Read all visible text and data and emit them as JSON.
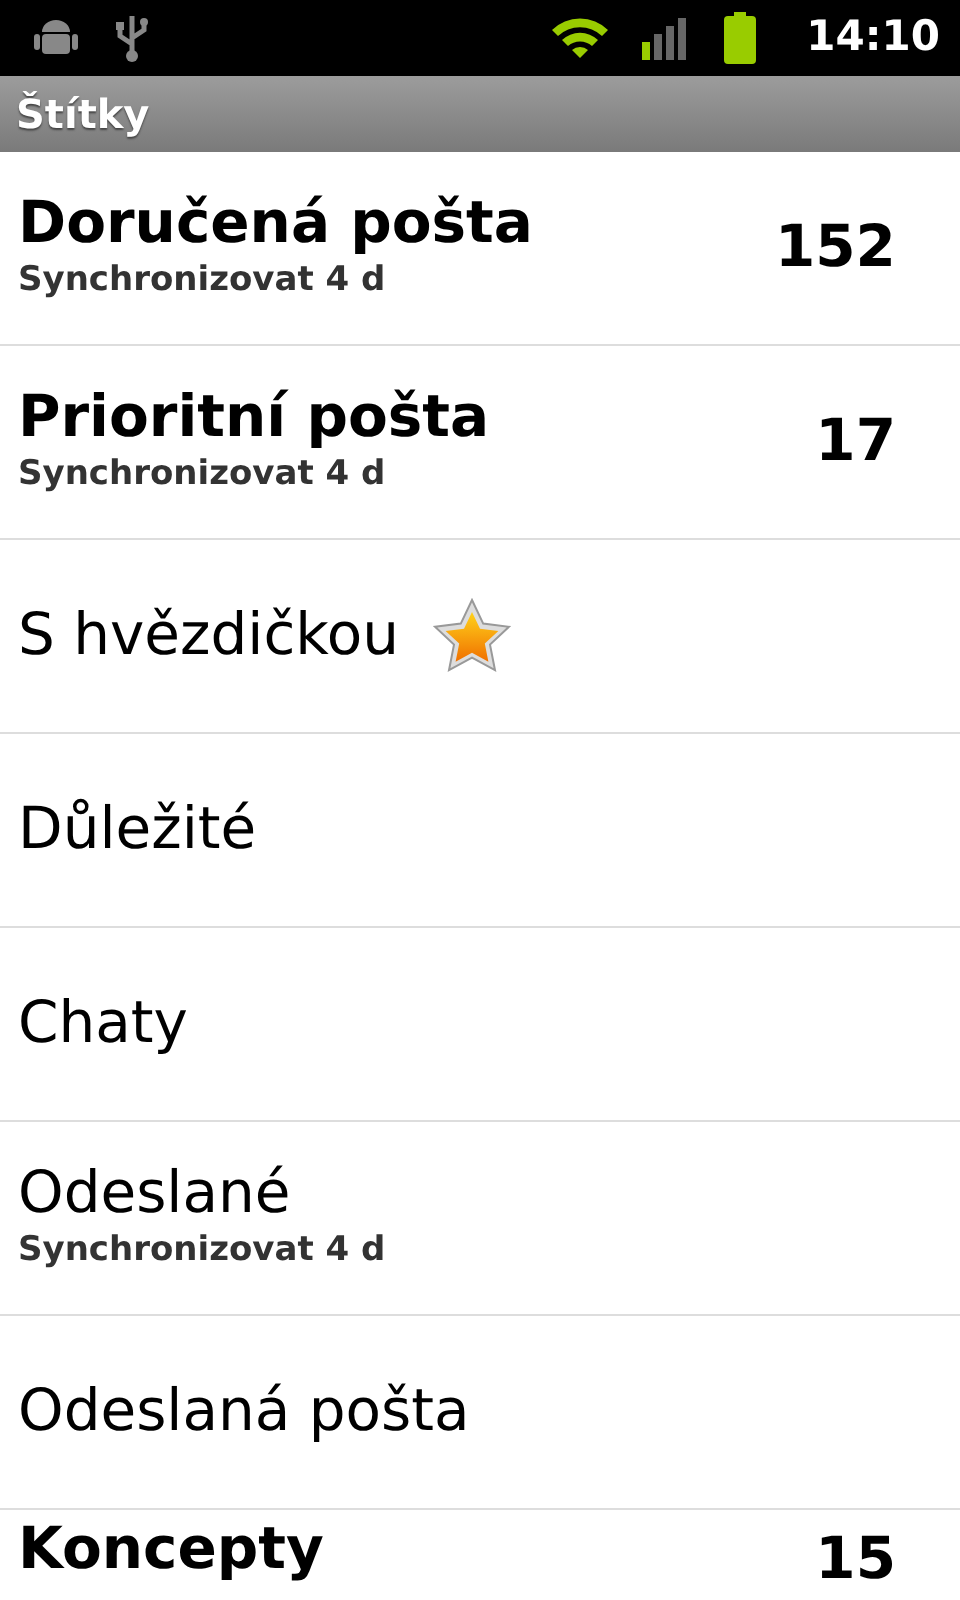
{
  "status_bar": {
    "time": "14:10"
  },
  "title_bar": {
    "title": "Štítky"
  },
  "labels": [
    {
      "name": "Doručená pošta",
      "unread": true,
      "sync": "Synchronizovat 4 d",
      "count": "152",
      "starred": false
    },
    {
      "name": "Prioritní pošta",
      "unread": true,
      "sync": "Synchronizovat 4 d",
      "count": "17",
      "starred": false
    },
    {
      "name": "S hvězdičkou",
      "unread": false,
      "starred": true
    },
    {
      "name": "Důležité",
      "unread": false,
      "starred": false
    },
    {
      "name": "Chaty",
      "unread": false,
      "starred": false
    },
    {
      "name": "Odeslané",
      "unread": false,
      "sync": "Synchronizovat 4 d",
      "starred": false
    },
    {
      "name": "Odeslaná pošta",
      "unread": false,
      "starred": false
    },
    {
      "name": "Koncepty",
      "unread": true,
      "count": "15",
      "starred": false
    }
  ]
}
